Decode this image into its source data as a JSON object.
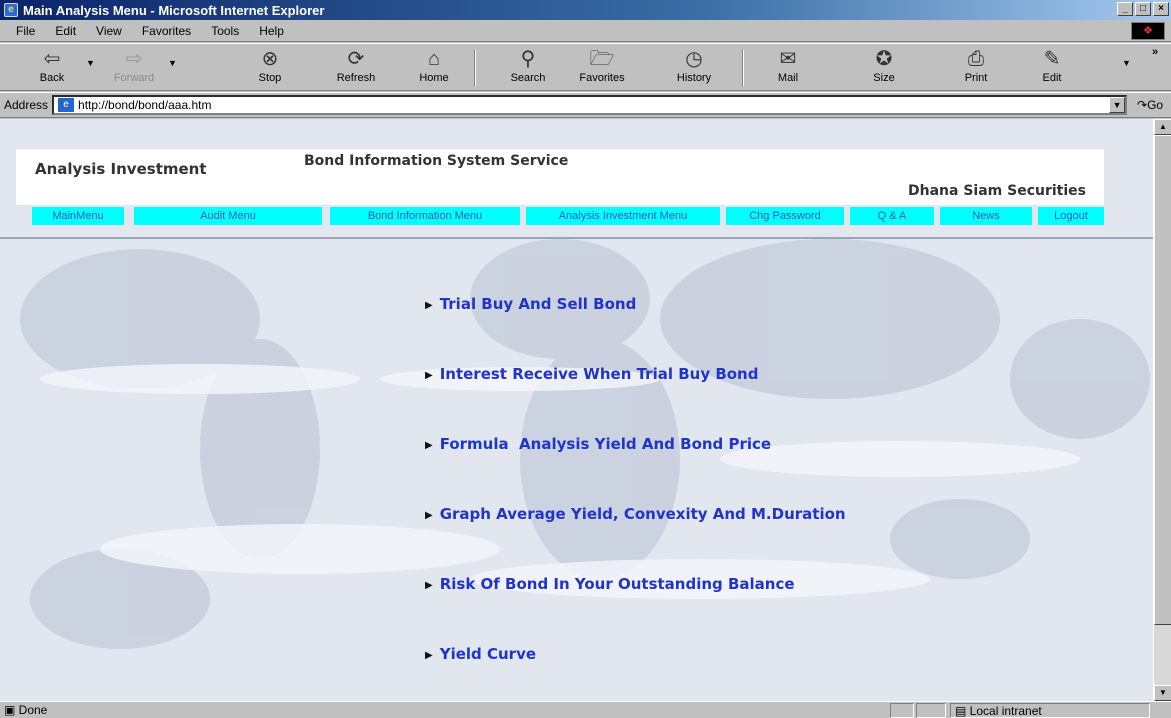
{
  "window": {
    "title": "Main Analysis Menu - Microsoft Internet Explorer",
    "controls": [
      "_",
      "□",
      "×"
    ]
  },
  "menubar": [
    "File",
    "Edit",
    "View",
    "Favorites",
    "Tools",
    "Help"
  ],
  "toolbar": {
    "back": "Back",
    "forward": "Forward",
    "stop": "Stop",
    "refresh": "Refresh",
    "home": "Home",
    "search": "Search",
    "favorites": "Favorites",
    "history": "History",
    "mail": "Mail",
    "size": "Size",
    "print": "Print",
    "edit": "Edit"
  },
  "address": {
    "label": "Address",
    "url": "http://bond/bond/aaa.htm",
    "go": "Go"
  },
  "header": {
    "left": "Analysis Investment",
    "center": "Bond Information System Service",
    "right": "Dhana Siam Securities"
  },
  "nav": [
    "MainMenu",
    "Audit Menu",
    "Bond Information Menu",
    "Analysis Investment Menu",
    "Chg Password",
    "Q & A",
    "News",
    "Logout"
  ],
  "links": [
    "Trial Buy And Sell Bond",
    "Interest Receive When Trial Buy Bond",
    "Formula  Analysis Yield And Bond Price",
    "Graph Average Yield, Convexity And M.Duration",
    "Risk Of Bond In Your Outstanding Balance",
    "Yield Curve"
  ],
  "status": {
    "text": "Done",
    "zone": "Local intranet"
  },
  "colors": {
    "nav_bg": "#00ffff",
    "link": "#2034c8",
    "titlebar": "#0a246a"
  }
}
